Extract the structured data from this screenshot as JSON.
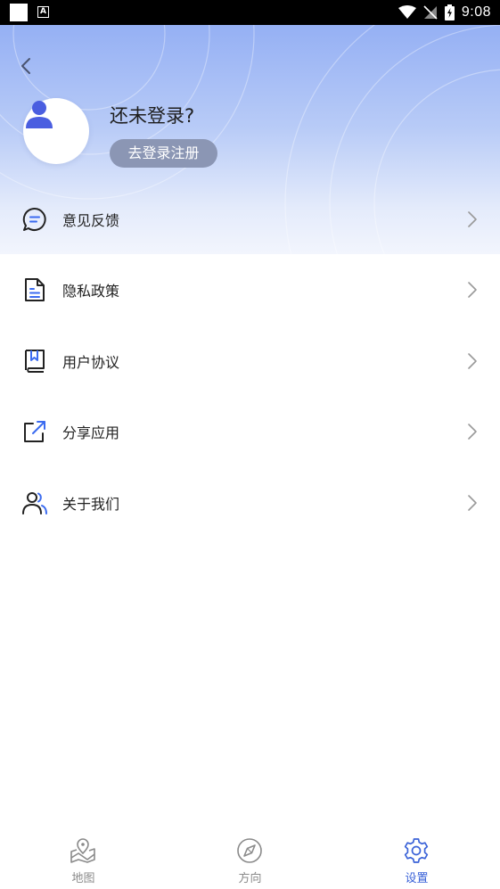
{
  "status_bar": {
    "time": "9:08",
    "left_badge": "A"
  },
  "header": {
    "back_icon": "chevron-left-icon",
    "login_title": "还未登录?",
    "login_button": "去登录注册",
    "avatar_icon": "user-icon"
  },
  "menu": {
    "items": [
      {
        "label": "意见反馈",
        "icon": "feedback-icon"
      },
      {
        "label": "隐私政策",
        "icon": "document-icon"
      },
      {
        "label": "用户协议",
        "icon": "book-icon"
      },
      {
        "label": "分享应用",
        "icon": "share-icon"
      },
      {
        "label": "关于我们",
        "icon": "users-icon"
      }
    ]
  },
  "bottom_nav": {
    "tabs": [
      {
        "label": "地图",
        "icon": "map-icon",
        "active": false
      },
      {
        "label": "方向",
        "icon": "compass-icon",
        "active": false
      },
      {
        "label": "设置",
        "icon": "gear-icon",
        "active": true
      }
    ]
  },
  "colors": {
    "accent": "#3a62d8",
    "avatar": "#4a5ee0",
    "icon_dark": "#222222",
    "icon_blue": "#3b6bf0",
    "header_top": "#95b0f4",
    "login_button_bg": "#8b96b4"
  }
}
